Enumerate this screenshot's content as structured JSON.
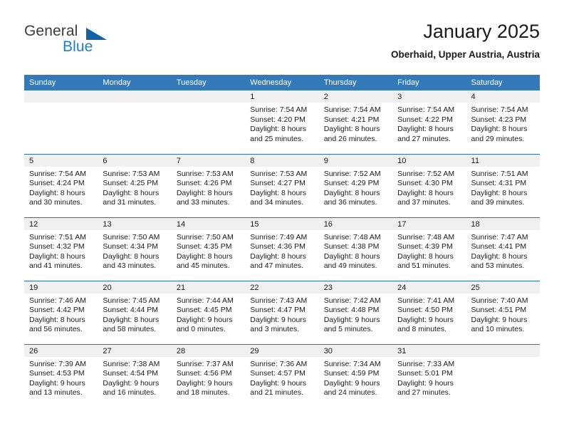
{
  "brand": {
    "name_part1": "General",
    "name_part2": "Blue",
    "logo_icon": "triangle-flag-icon"
  },
  "header": {
    "title": "January 2025",
    "location": "Oberhaid, Upper Austria, Austria"
  },
  "theme": {
    "header_blue": "#3479b8",
    "row_divider_blue": "#2f6fae",
    "daynum_strip": "#f0f0f0",
    "brand_blue": "#1f7fc4",
    "logo_blue": "#1464a5"
  },
  "calendar": {
    "weekday_headers": [
      "Sunday",
      "Monday",
      "Tuesday",
      "Wednesday",
      "Thursday",
      "Friday",
      "Saturday"
    ],
    "weeks": [
      [
        {
          "day": "",
          "empty": true,
          "lines": []
        },
        {
          "day": "",
          "empty": true,
          "lines": []
        },
        {
          "day": "",
          "empty": true,
          "lines": []
        },
        {
          "day": "1",
          "lines": [
            "Sunrise: 7:54 AM",
            "Sunset: 4:20 PM",
            "Daylight: 8 hours",
            "and 25 minutes."
          ]
        },
        {
          "day": "2",
          "lines": [
            "Sunrise: 7:54 AM",
            "Sunset: 4:21 PM",
            "Daylight: 8 hours",
            "and 26 minutes."
          ]
        },
        {
          "day": "3",
          "lines": [
            "Sunrise: 7:54 AM",
            "Sunset: 4:22 PM",
            "Daylight: 8 hours",
            "and 27 minutes."
          ]
        },
        {
          "day": "4",
          "lines": [
            "Sunrise: 7:54 AM",
            "Sunset: 4:23 PM",
            "Daylight: 8 hours",
            "and 29 minutes."
          ]
        }
      ],
      [
        {
          "day": "5",
          "lines": [
            "Sunrise: 7:54 AM",
            "Sunset: 4:24 PM",
            "Daylight: 8 hours",
            "and 30 minutes."
          ]
        },
        {
          "day": "6",
          "lines": [
            "Sunrise: 7:53 AM",
            "Sunset: 4:25 PM",
            "Daylight: 8 hours",
            "and 31 minutes."
          ]
        },
        {
          "day": "7",
          "lines": [
            "Sunrise: 7:53 AM",
            "Sunset: 4:26 PM",
            "Daylight: 8 hours",
            "and 33 minutes."
          ]
        },
        {
          "day": "8",
          "lines": [
            "Sunrise: 7:53 AM",
            "Sunset: 4:27 PM",
            "Daylight: 8 hours",
            "and 34 minutes."
          ]
        },
        {
          "day": "9",
          "lines": [
            "Sunrise: 7:52 AM",
            "Sunset: 4:29 PM",
            "Daylight: 8 hours",
            "and 36 minutes."
          ]
        },
        {
          "day": "10",
          "lines": [
            "Sunrise: 7:52 AM",
            "Sunset: 4:30 PM",
            "Daylight: 8 hours",
            "and 37 minutes."
          ]
        },
        {
          "day": "11",
          "lines": [
            "Sunrise: 7:51 AM",
            "Sunset: 4:31 PM",
            "Daylight: 8 hours",
            "and 39 minutes."
          ]
        }
      ],
      [
        {
          "day": "12",
          "lines": [
            "Sunrise: 7:51 AM",
            "Sunset: 4:32 PM",
            "Daylight: 8 hours",
            "and 41 minutes."
          ]
        },
        {
          "day": "13",
          "lines": [
            "Sunrise: 7:50 AM",
            "Sunset: 4:34 PM",
            "Daylight: 8 hours",
            "and 43 minutes."
          ]
        },
        {
          "day": "14",
          "lines": [
            "Sunrise: 7:50 AM",
            "Sunset: 4:35 PM",
            "Daylight: 8 hours",
            "and 45 minutes."
          ]
        },
        {
          "day": "15",
          "lines": [
            "Sunrise: 7:49 AM",
            "Sunset: 4:36 PM",
            "Daylight: 8 hours",
            "and 47 minutes."
          ]
        },
        {
          "day": "16",
          "lines": [
            "Sunrise: 7:48 AM",
            "Sunset: 4:38 PM",
            "Daylight: 8 hours",
            "and 49 minutes."
          ]
        },
        {
          "day": "17",
          "lines": [
            "Sunrise: 7:48 AM",
            "Sunset: 4:39 PM",
            "Daylight: 8 hours",
            "and 51 minutes."
          ]
        },
        {
          "day": "18",
          "lines": [
            "Sunrise: 7:47 AM",
            "Sunset: 4:41 PM",
            "Daylight: 8 hours",
            "and 53 minutes."
          ]
        }
      ],
      [
        {
          "day": "19",
          "lines": [
            "Sunrise: 7:46 AM",
            "Sunset: 4:42 PM",
            "Daylight: 8 hours",
            "and 56 minutes."
          ]
        },
        {
          "day": "20",
          "lines": [
            "Sunrise: 7:45 AM",
            "Sunset: 4:44 PM",
            "Daylight: 8 hours",
            "and 58 minutes."
          ]
        },
        {
          "day": "21",
          "lines": [
            "Sunrise: 7:44 AM",
            "Sunset: 4:45 PM",
            "Daylight: 9 hours",
            "and 0 minutes."
          ]
        },
        {
          "day": "22",
          "lines": [
            "Sunrise: 7:43 AM",
            "Sunset: 4:47 PM",
            "Daylight: 9 hours",
            "and 3 minutes."
          ]
        },
        {
          "day": "23",
          "lines": [
            "Sunrise: 7:42 AM",
            "Sunset: 4:48 PM",
            "Daylight: 9 hours",
            "and 5 minutes."
          ]
        },
        {
          "day": "24",
          "lines": [
            "Sunrise: 7:41 AM",
            "Sunset: 4:50 PM",
            "Daylight: 9 hours",
            "and 8 minutes."
          ]
        },
        {
          "day": "25",
          "lines": [
            "Sunrise: 7:40 AM",
            "Sunset: 4:51 PM",
            "Daylight: 9 hours",
            "and 10 minutes."
          ]
        }
      ],
      [
        {
          "day": "26",
          "lines": [
            "Sunrise: 7:39 AM",
            "Sunset: 4:53 PM",
            "Daylight: 9 hours",
            "and 13 minutes."
          ]
        },
        {
          "day": "27",
          "lines": [
            "Sunrise: 7:38 AM",
            "Sunset: 4:54 PM",
            "Daylight: 9 hours",
            "and 16 minutes."
          ]
        },
        {
          "day": "28",
          "lines": [
            "Sunrise: 7:37 AM",
            "Sunset: 4:56 PM",
            "Daylight: 9 hours",
            "and 18 minutes."
          ]
        },
        {
          "day": "29",
          "lines": [
            "Sunrise: 7:36 AM",
            "Sunset: 4:57 PM",
            "Daylight: 9 hours",
            "and 21 minutes."
          ]
        },
        {
          "day": "30",
          "lines": [
            "Sunrise: 7:34 AM",
            "Sunset: 4:59 PM",
            "Daylight: 9 hours",
            "and 24 minutes."
          ]
        },
        {
          "day": "31",
          "lines": [
            "Sunrise: 7:33 AM",
            "Sunset: 5:01 PM",
            "Daylight: 9 hours",
            "and 27 minutes."
          ]
        },
        {
          "day": "",
          "empty": true,
          "lines": []
        }
      ]
    ]
  }
}
